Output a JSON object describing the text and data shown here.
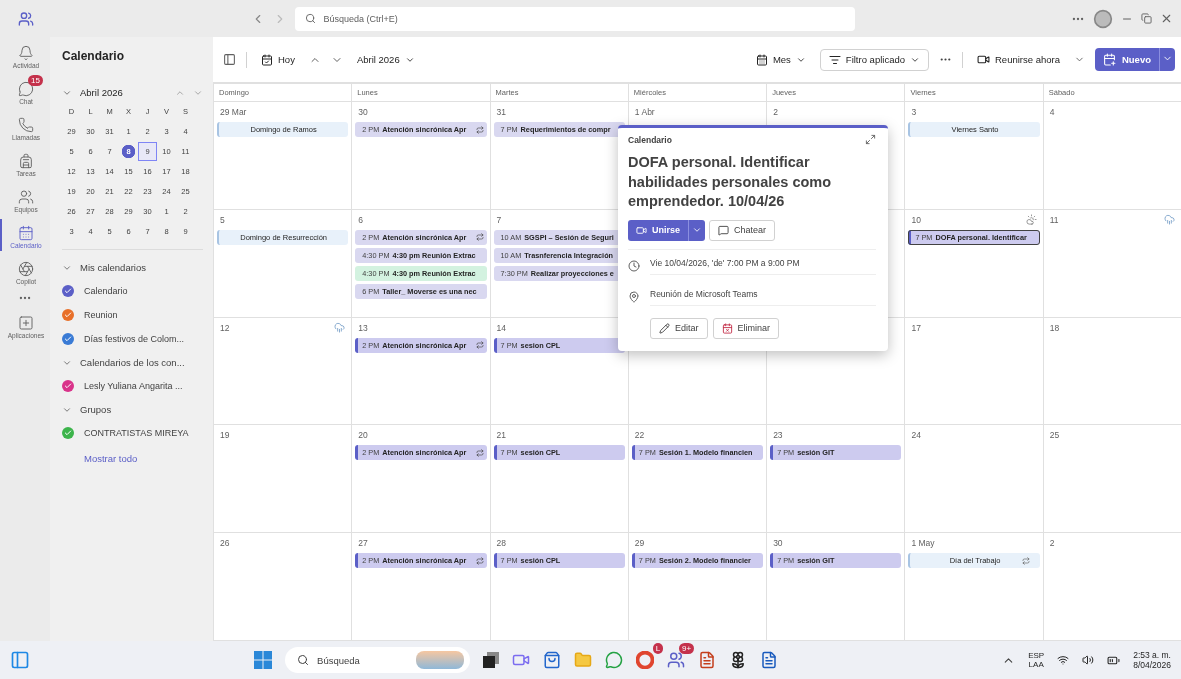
{
  "title_bar": {
    "search": {
      "placeholder": "Búsqueda (Ctrl+E)"
    }
  },
  "rail": [
    {
      "label": "Actividad",
      "selected": false
    },
    {
      "label": "Chat",
      "selected": false,
      "badge": "15"
    },
    {
      "label": "Llamadas",
      "selected": false
    },
    {
      "label": "Tareas",
      "selected": false
    },
    {
      "label": "Equipos",
      "selected": false
    },
    {
      "label": "Calendario",
      "selected": true
    },
    {
      "label": "Copilot",
      "selected": false
    },
    {
      "label": "Aplicaciones",
      "selected": false
    }
  ],
  "sidebar": {
    "title": "Calendario",
    "mini_calendar": {
      "month": "Abril 2026",
      "weekdays": [
        "D",
        "L",
        "M",
        "X",
        "J",
        "V",
        "S"
      ],
      "days": [
        {
          "label": "29",
          "today": false,
          "selected": false
        },
        {
          "label": "30",
          "today": false,
          "selected": false
        },
        {
          "label": "31",
          "today": false,
          "selected": false
        },
        {
          "label": "1",
          "today": false,
          "selected": false
        },
        {
          "label": "2",
          "today": false,
          "selected": false
        },
        {
          "label": "3",
          "today": false,
          "selected": false
        },
        {
          "label": "4",
          "today": false,
          "selected": false
        },
        {
          "label": "5",
          "today": false,
          "selected": false
        },
        {
          "label": "6",
          "today": false,
          "selected": false
        },
        {
          "label": "7",
          "today": false,
          "selected": false
        },
        {
          "label": "8",
          "today": true,
          "selected": false
        },
        {
          "label": "9",
          "today": false,
          "selected": true
        },
        {
          "label": "10",
          "today": false,
          "selected": false
        },
        {
          "label": "11",
          "today": false,
          "selected": false
        },
        {
          "label": "12",
          "today": false,
          "selected": false
        },
        {
          "label": "13",
          "today": false,
          "selected": false
        },
        {
          "label": "14",
          "today": false,
          "selected": false
        },
        {
          "label": "15",
          "today": false,
          "selected": false
        },
        {
          "label": "16",
          "today": false,
          "selected": false
        },
        {
          "label": "17",
          "today": false,
          "selected": false
        },
        {
          "label": "18",
          "today": false,
          "selected": false
        },
        {
          "label": "19",
          "today": false,
          "selected": false
        },
        {
          "label": "20",
          "today": false,
          "selected": false
        },
        {
          "label": "21",
          "today": false,
          "selected": false
        },
        {
          "label": "22",
          "today": false,
          "selected": false
        },
        {
          "label": "23",
          "today": false,
          "selected": false
        },
        {
          "label": "24",
          "today": false,
          "selected": false
        },
        {
          "label": "25",
          "today": false,
          "selected": false
        },
        {
          "label": "26",
          "today": false,
          "selected": false
        },
        {
          "label": "27",
          "today": false,
          "selected": false
        },
        {
          "label": "28",
          "today": false,
          "selected": false
        },
        {
          "label": "29",
          "today": false,
          "selected": false
        },
        {
          "label": "30",
          "today": false,
          "selected": false
        },
        {
          "label": "1",
          "today": false,
          "selected": false
        },
        {
          "label": "2",
          "today": false,
          "selected": false
        },
        {
          "label": "3",
          "today": false,
          "selected": false
        },
        {
          "label": "4",
          "today": false,
          "selected": false
        },
        {
          "label": "5",
          "today": false,
          "selected": false
        },
        {
          "label": "6",
          "today": false,
          "selected": false
        },
        {
          "label": "7",
          "today": false,
          "selected": false
        },
        {
          "label": "8",
          "today": false,
          "selected": false
        },
        {
          "label": "9",
          "today": false,
          "selected": false
        }
      ]
    },
    "groups": [
      {
        "title": "Mis calendarios",
        "expanded": true,
        "items": [
          {
            "label": "Calendario",
            "color": "#5b5fc7",
            "checked": true
          },
          {
            "label": "Reunion",
            "color": "#e8702a",
            "checked": true
          },
          {
            "label": "Días festivos de Colom...",
            "color": "#3a7bd5",
            "checked": true
          }
        ]
      },
      {
        "title": "Calendarios de los con...",
        "expanded": true,
        "items": [
          {
            "label": "Lesly Yuliana Angarita ...",
            "color": "#d9338a",
            "checked": true
          }
        ]
      },
      {
        "title": "Grupos",
        "expanded": true,
        "items": [
          {
            "label": "CONTRATISTAS MIREYA",
            "color": "#3cb44b",
            "checked": true
          }
        ]
      }
    ],
    "show_all": "Mostrar todo"
  },
  "toolbar": {
    "today": "Hoy",
    "month": "Abril 2026",
    "view": "Mes",
    "filter": "Filtro aplicado",
    "meet_now": "Reunirse ahora",
    "new": "Nuevo"
  },
  "calendar": {
    "weekdays": [
      "Domingo",
      "Lunes",
      "Martes",
      "Miércoles",
      "Jueves",
      "Viernes",
      "Sábado"
    ],
    "weeks": [
      {
        "days": [
          {
            "label": "29 Mar",
            "events": [
              {
                "kind": "holiday",
                "title": "Domingo de Ramos",
                "recurring": false
              }
            ]
          },
          {
            "label": "30",
            "events": [
              {
                "kind": "event",
                "time": "2 PM",
                "title": "Atención sincrónica Apr",
                "recurring": true,
                "past": true,
                "selected": false,
                "color": "#d9d8f0"
              }
            ]
          },
          {
            "label": "31",
            "events": [
              {
                "kind": "event",
                "time": "7 PM",
                "title": "Requerimientos de compr",
                "recurring": false,
                "past": true,
                "selected": false,
                "color": "#d9d8f0"
              }
            ]
          },
          {
            "label": "1 Abr"
          },
          {
            "label": "2"
          },
          {
            "label": "3",
            "events": [
              {
                "kind": "holiday",
                "title": "Viernes Santo",
                "recurring": false
              }
            ]
          },
          {
            "label": "4"
          }
        ]
      },
      {
        "days": [
          {
            "label": "5",
            "events": [
              {
                "kind": "holiday",
                "title": "Domingo de Resurrección",
                "recurring": false
              }
            ]
          },
          {
            "label": "6",
            "events": [
              {
                "kind": "event",
                "time": "2 PM",
                "title": "Atención sincrónica Apr",
                "recurring": true,
                "past": true,
                "selected": false,
                "color": "#d9d8f0"
              },
              {
                "kind": "event",
                "time": "4:30 PM",
                "title": "4:30 pm Reunión Extrac",
                "recurring": false,
                "past": true,
                "selected": false,
                "color": "#d9d8f0"
              },
              {
                "kind": "event",
                "time": "4:30 PM",
                "title": "4:30 pm Reunión Extrac",
                "recurring": false,
                "past": true,
                "selected": false,
                "color": "#d3f2e0"
              },
              {
                "kind": "event",
                "time": "6 PM",
                "title": "Taller_ Moverse es una nec",
                "recurring": false,
                "past": true,
                "selected": false,
                "color": "#d9d8f0"
              }
            ]
          },
          {
            "label": "7",
            "events": [
              {
                "kind": "event",
                "time": "10 AM",
                "title": "SGSPI – Sesión de Seguri",
                "recurring": false,
                "past": true,
                "selected": false,
                "color": "#d9d8f0"
              },
              {
                "kind": "event",
                "time": "10 AM",
                "title": "Trasnferencia Integración",
                "recurring": false,
                "past": true,
                "selected": false,
                "color": "#d9d8f0"
              },
              {
                "kind": "event",
                "time": "7:30 PM",
                "title": "Realizar proyecciones e",
                "recurring": false,
                "past": true,
                "selected": false,
                "color": "#d9d8f0"
              }
            ]
          },
          {
            "kind": "covered"
          },
          {
            "kind": "covered"
          },
          {
            "label": "10",
            "kind": "sun-cloud",
            "events": [
              {
                "kind": "event",
                "time": "7 PM",
                "title": "DOFA personal. Identificar",
                "recurring": false,
                "past": false,
                "selected": true,
                "color": "#cdcbef"
              }
            ]
          },
          {
            "label": "11",
            "kind": "rain"
          }
        ]
      },
      {
        "days": [
          {
            "label": "12",
            "kind": "rain"
          },
          {
            "label": "13",
            "events": [
              {
                "kind": "event",
                "time": "2 PM",
                "title": "Atención sincrónica Apr",
                "recurring": true,
                "past": false,
                "selected": false,
                "color": "#cdcbef"
              }
            ]
          },
          {
            "label": "14",
            "events": [
              {
                "kind": "event",
                "time": "7 PM",
                "title": "sesion CPL",
                "recurring": false,
                "past": false,
                "selected": false,
                "color": "#cdcbef"
              }
            ]
          },
          {
            "kind": "blank"
          },
          {
            "kind": "blank"
          },
          {
            "label": "17"
          },
          {
            "label": "18"
          }
        ]
      },
      {
        "days": [
          {
            "label": "19"
          },
          {
            "label": "20",
            "events": [
              {
                "kind": "event",
                "time": "2 PM",
                "title": "Atención sincrónica Apr",
                "recurring": true,
                "past": false,
                "selected": false,
                "color": "#cdcbef"
              }
            ]
          },
          {
            "label": "21",
            "events": [
              {
                "kind": "event",
                "time": "7 PM",
                "title": "sesión CPL",
                "recurring": false,
                "past": false,
                "selected": false,
                "color": "#cdcbef"
              }
            ]
          },
          {
            "label": "22",
            "events": [
              {
                "kind": "event",
                "time": "7 PM",
                "title": "Sesión 1. Modelo financien",
                "recurring": false,
                "past": false,
                "selected": false,
                "color": "#cdcbef"
              }
            ]
          },
          {
            "label": "23",
            "events": [
              {
                "kind": "event",
                "time": "7 PM",
                "title": "sesión GIT",
                "recurring": false,
                "past": false,
                "selected": false,
                "color": "#cdcbef"
              }
            ]
          },
          {
            "label": "24"
          },
          {
            "label": "25"
          }
        ]
      },
      {
        "days": [
          {
            "label": "26"
          },
          {
            "label": "27",
            "events": [
              {
                "kind": "event",
                "time": "2 PM",
                "title": "Atención sincrónica Apr",
                "recurring": true,
                "past": false,
                "selected": false,
                "color": "#cdcbef"
              }
            ]
          },
          {
            "label": "28",
            "events": [
              {
                "kind": "event",
                "time": "7 PM",
                "title": "sesión CPL",
                "recurring": false,
                "past": false,
                "selected": false,
                "color": "#cdcbef"
              }
            ]
          },
          {
            "label": "29",
            "events": [
              {
                "kind": "event",
                "time": "7 PM",
                "title": "Sesión 2. Modelo financier",
                "recurring": false,
                "past": false,
                "selected": false,
                "color": "#cdcbef"
              }
            ]
          },
          {
            "label": "30",
            "events": [
              {
                "kind": "event",
                "time": "7 PM",
                "title": "sesión GIT",
                "recurring": false,
                "past": false,
                "selected": false,
                "color": "#cdcbef"
              }
            ]
          },
          {
            "label": "1 May",
            "events": [
              {
                "kind": "holiday",
                "title": "Día del Trabajo",
                "recurring": true
              }
            ]
          },
          {
            "label": "2"
          }
        ]
      }
    ]
  },
  "popup": {
    "calendar": "Calendario",
    "title": "DOFA personal. Identificar habilidades personales como emprendedor. 10/04/26",
    "join": "Unirse",
    "chat": "Chatear",
    "time": "Vie 10/04/2026, 'de' 7:00 PM a 9:00 PM",
    "location": "Reunión de Microsoft Teams",
    "edit": "Editar",
    "delete": "Eliminar"
  },
  "taskbar": {
    "search": {
      "placeholder": "Búsqueda"
    },
    "badges": [
      "L",
      "9+"
    ],
    "language": "ESP",
    "layout": "LAA",
    "time": "2:53 a. m.",
    "date": "8/04/2026"
  }
}
